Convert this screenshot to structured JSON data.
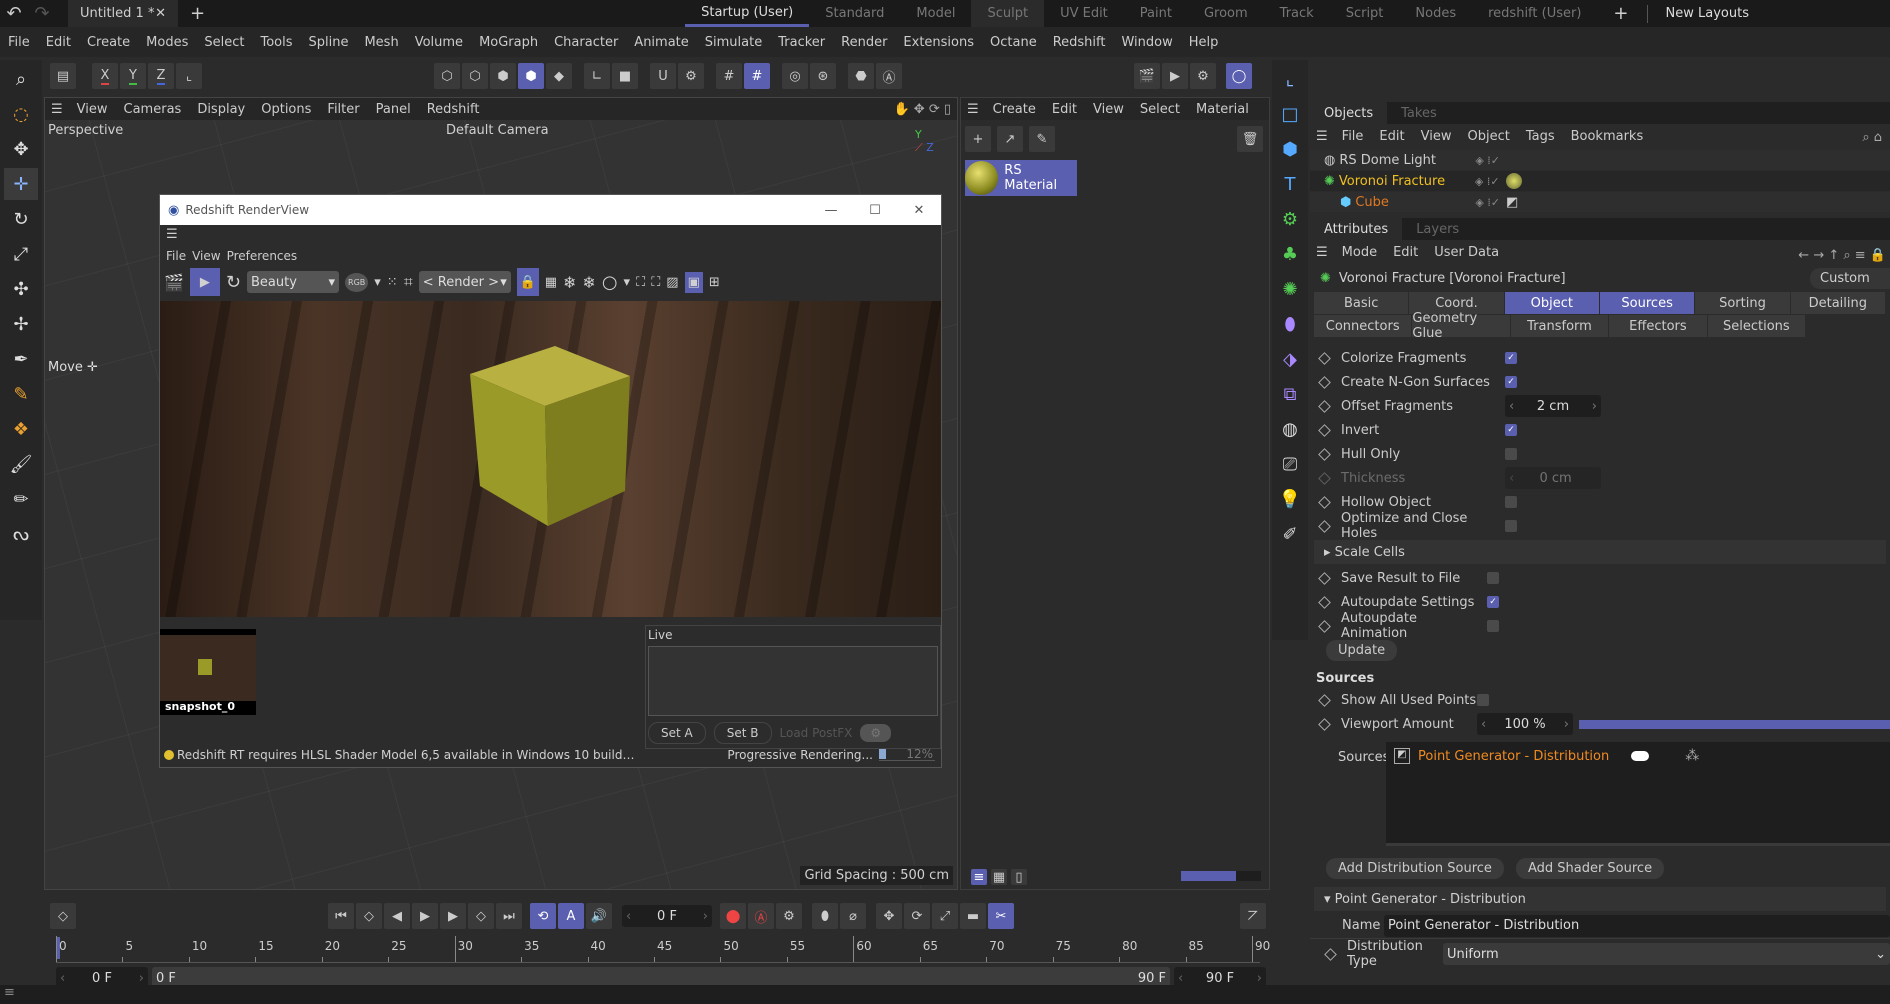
{
  "app": {
    "doc_tab": "Untitled 1 *",
    "layouts": [
      "Startup (User)",
      "Standard",
      "Model",
      "Sculpt",
      "UV Edit",
      "Paint",
      "Groom",
      "Track",
      "Script",
      "Nodes",
      "redshift (User)"
    ],
    "active_layout": "Startup (User)",
    "new_layouts": "New Layouts"
  },
  "menu": [
    "File",
    "Edit",
    "Create",
    "Modes",
    "Select",
    "Tools",
    "Spline",
    "Mesh",
    "Volume",
    "MoGraph",
    "Character",
    "Animate",
    "Simulate",
    "Tracker",
    "Render",
    "Extensions",
    "Octane",
    "Redshift",
    "Window",
    "Help"
  ],
  "toolbar": {
    "x": "X",
    "y": "Y",
    "z": "Z"
  },
  "viewport": {
    "menu": [
      "View",
      "Cameras",
      "Display",
      "Options",
      "Filter",
      "Panel",
      "Redshift"
    ],
    "name": "Perspective",
    "camera": "Default Camera",
    "move_label": "Move",
    "grid_spacing": "Grid Spacing : 500 cm"
  },
  "material_manager": {
    "menu": [
      "Create",
      "Edit",
      "View",
      "Select",
      "Material"
    ],
    "material": "RS Material"
  },
  "objects": {
    "tabs": [
      "Objects",
      "Takes"
    ],
    "menu": [
      "File",
      "Edit",
      "View",
      "Object",
      "Tags",
      "Bookmarks"
    ],
    "items": [
      {
        "name": "RS Dome Light",
        "color": "#cccccc"
      },
      {
        "name": "Voronoi Fracture",
        "color": "#f0c020"
      },
      {
        "name": "Cube",
        "color": "#e07820"
      }
    ]
  },
  "attributes": {
    "tabs": [
      "Attributes",
      "Layers"
    ],
    "menu": [
      "Mode",
      "Edit",
      "User Data"
    ],
    "title": "Voronoi Fracture [Voronoi Fracture]",
    "preset": "Custom",
    "tabs_row1": [
      "Basic",
      "Coord.",
      "Object",
      "Sources",
      "Sorting",
      "Detailing"
    ],
    "tabs_row2": [
      "Connectors",
      "Geometry Glue",
      "Transform",
      "Effectors",
      "Selections"
    ],
    "active_tabs": [
      "Object",
      "Sources"
    ],
    "params1": [
      {
        "label": "Colorize Fragments",
        "type": "check",
        "checked": true
      },
      {
        "label": "Create N-Gon Surfaces",
        "type": "check",
        "checked": true
      },
      {
        "label": "Offset Fragments",
        "type": "field",
        "value": "2 cm"
      },
      {
        "label": "Invert",
        "type": "check",
        "checked": true
      },
      {
        "label": "Hull Only",
        "type": "check",
        "checked": false
      },
      {
        "label": "Thickness",
        "type": "field",
        "value": "0 cm",
        "disabled": true
      },
      {
        "label": "Hollow Object",
        "type": "check",
        "checked": false
      },
      {
        "label": "Optimize and Close Holes",
        "type": "check",
        "checked": false
      }
    ],
    "scale_cells": "Scale Cells",
    "params2": [
      {
        "label": "Save Result to File",
        "checked": false
      },
      {
        "label": "Autoupdate Settings",
        "checked": true
      },
      {
        "label": "Autoupdate Animation",
        "checked": false
      }
    ],
    "update": "Update",
    "sources_header": "Sources",
    "show_all_used_points": "Show All Used Points",
    "viewport_amount_label": "Viewport Amount",
    "viewport_amount": "100 %",
    "viewport_amount_fraction": 1.0,
    "sources_label": "Sources",
    "source_item": "Point Generator - Distribution",
    "add_distribution": "Add Distribution Source",
    "add_shader": "Add Shader Source",
    "pg_header": "Point Generator - Distribution",
    "name_label": "Name",
    "name_value": "Point Generator - Distribution",
    "dist_type_label": "Distribution Type",
    "dist_type_value": "Uniform"
  },
  "renderview": {
    "title": "Redshift RenderView",
    "menu": [
      "File",
      "View",
      "Preferences"
    ],
    "aov": "Beauty",
    "rgb": "RGB",
    "render_select": "< Render >",
    "snapshot": "snapshot_0",
    "live": "Live",
    "set_a": "Set A",
    "set_b": "Set B",
    "load_postfx": "Load PostFX",
    "status": "Redshift RT requires HLSL Shader Model 6,5 available in Windows 10 build…",
    "progress_label": "Progressive Rendering...",
    "progress": "12%",
    "progress_fraction": 0.12
  },
  "timeline": {
    "current_frame": "0 F",
    "ticks": [
      "0",
      "5",
      "10",
      "15",
      "20",
      "25",
      "30",
      "35",
      "40",
      "45",
      "50",
      "55",
      "60",
      "65",
      "70",
      "75",
      "80",
      "85",
      "90"
    ],
    "start": "0 F",
    "range_start": "0 F",
    "range_end": "90 F",
    "end": "90 F"
  },
  "colors": {
    "accent": "#5a5fb0"
  }
}
